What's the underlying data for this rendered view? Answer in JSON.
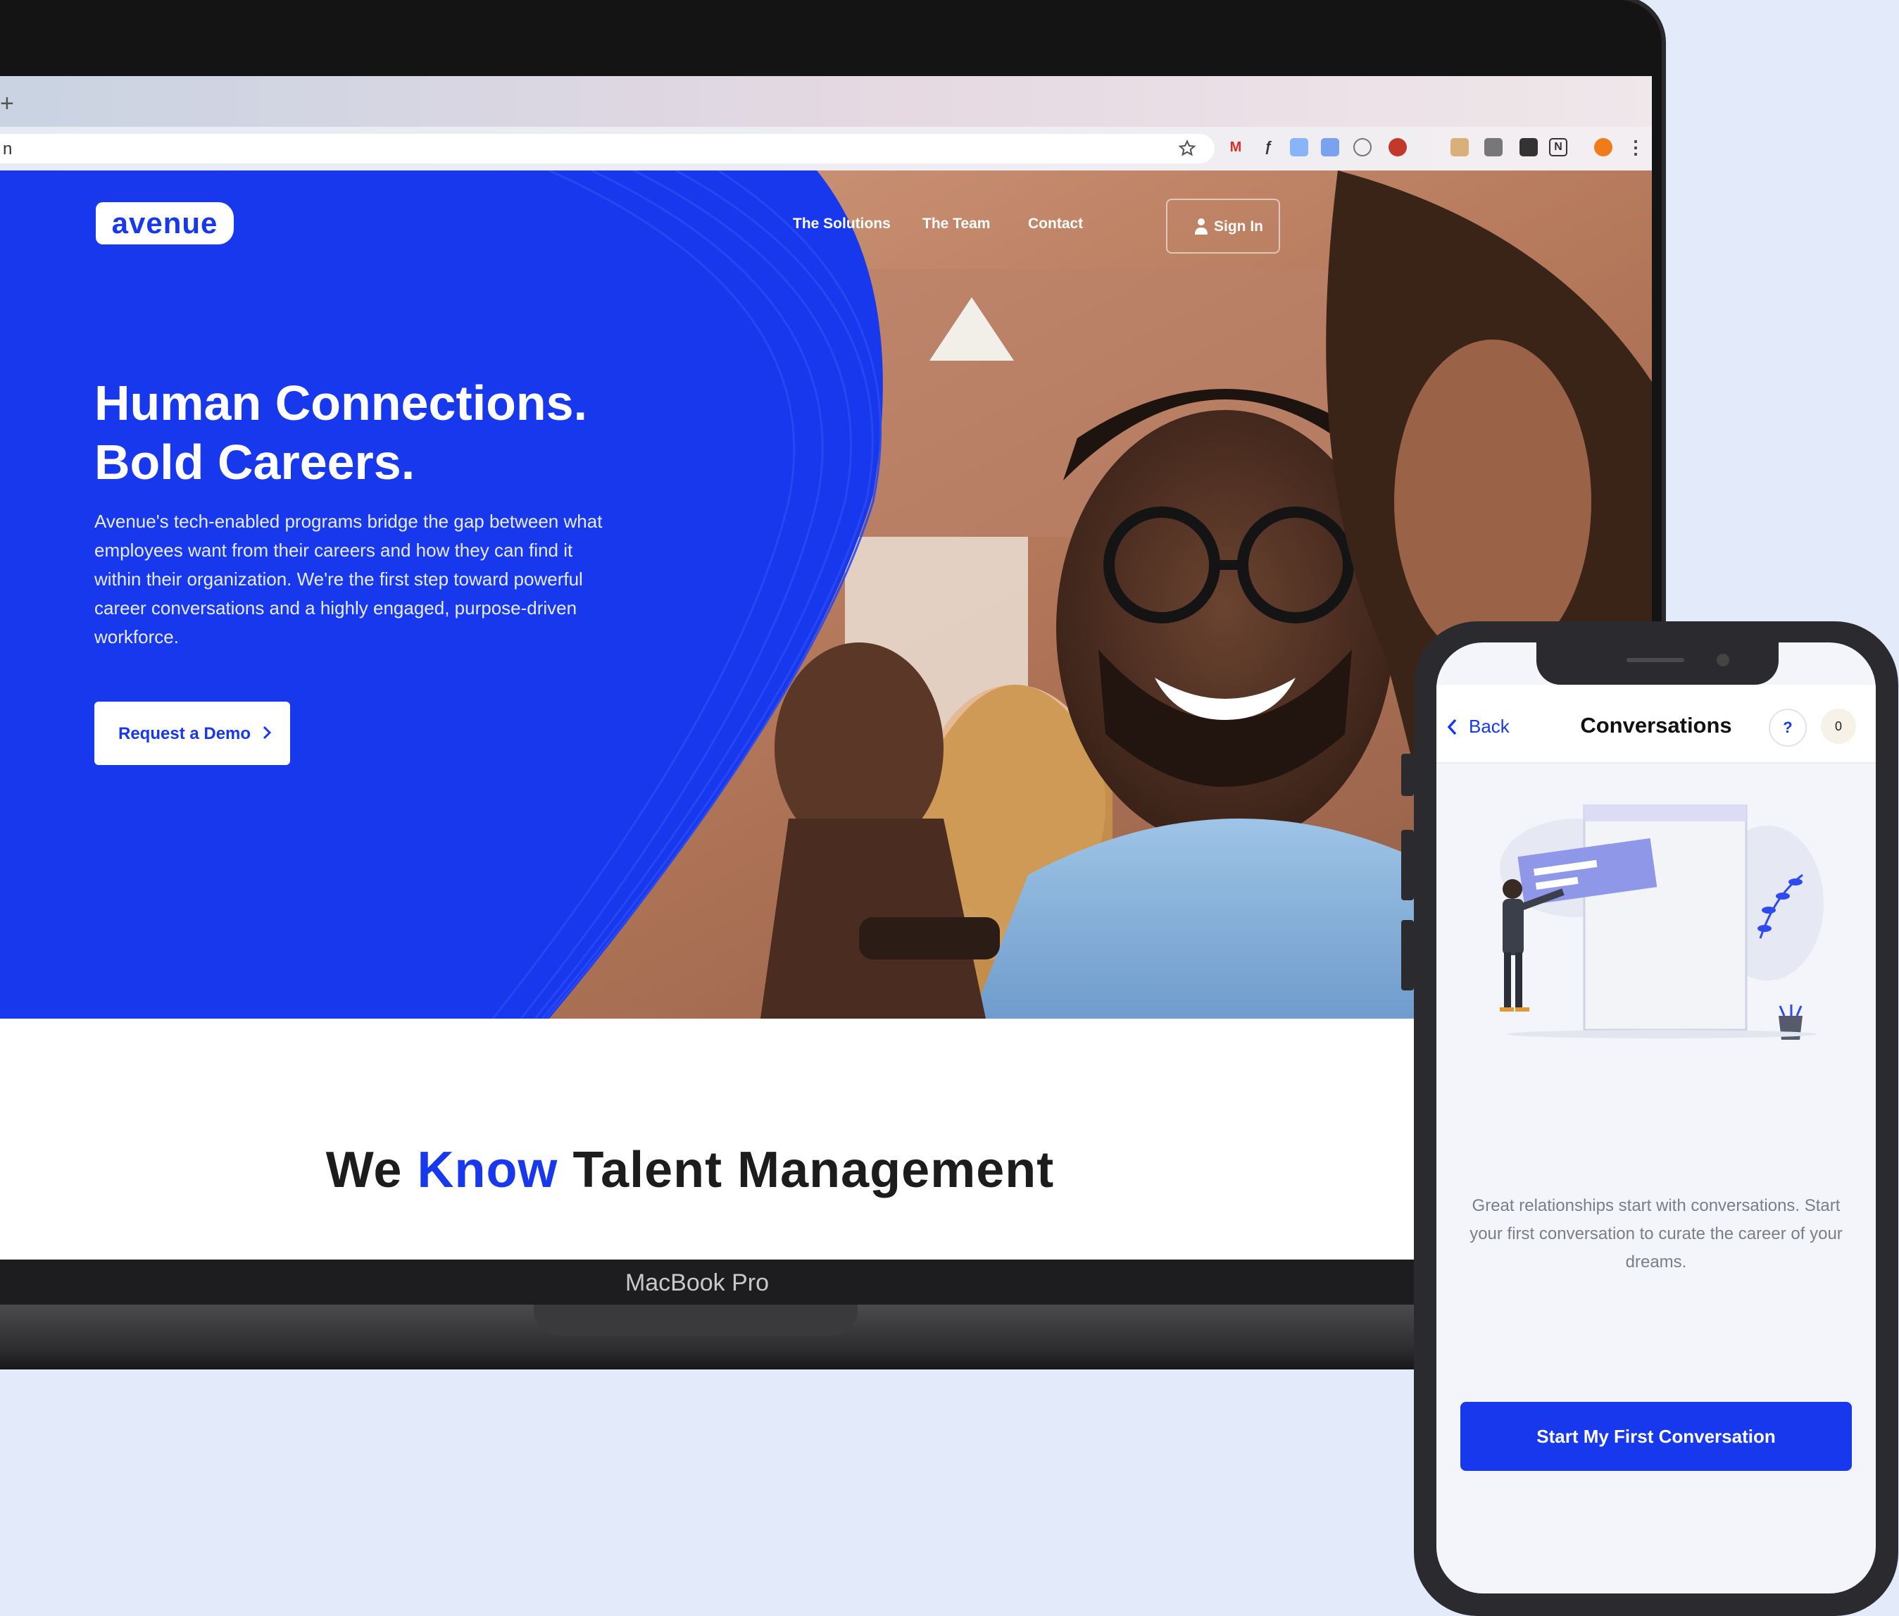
{
  "browser": {
    "new_tab_symbol": "+",
    "address_fragment": "n",
    "bookmark_icon": "star-icon",
    "extensions": [
      "gmail-icon",
      "formula-icon",
      "extension-icon",
      "extension-icon",
      "pocket-icon",
      "shield-icon",
      "extension-icon",
      "extension-icon",
      "extension-icon",
      "extension-icon",
      "notion-icon",
      "profile-icon",
      "menu-icon"
    ]
  },
  "site": {
    "logo": "avenue",
    "nav": [
      "The Solutions",
      "The Team",
      "Contact"
    ],
    "sign_in": "Sign In",
    "hero_title_line1": "Human Connections.",
    "hero_title_line2": "Bold Careers.",
    "hero_description": "Avenue's tech-enabled programs bridge the gap between what employees want from their careers and how they can find it within their organization. We're the first step toward powerful career conversations and a highly engaged, purpose-driven workforce.",
    "demo_button": "Request a Demo",
    "section_heading_before": "We",
    "section_heading_highlight": "Know",
    "section_heading_after": "Talent Management"
  },
  "laptop": {
    "label": "MacBook Pro"
  },
  "phone": {
    "back_label": "Back",
    "title": "Conversations",
    "help": "?",
    "badge_count": "0",
    "empty_message": "Great relationships start with conversations. Start your first conversation to curate the career of your dreams.",
    "cta": "Start My First Conversation"
  },
  "colors": {
    "brand_blue": "#1838ee",
    "background": "#e3ebfb",
    "device_dark": "#2b2b2f"
  }
}
